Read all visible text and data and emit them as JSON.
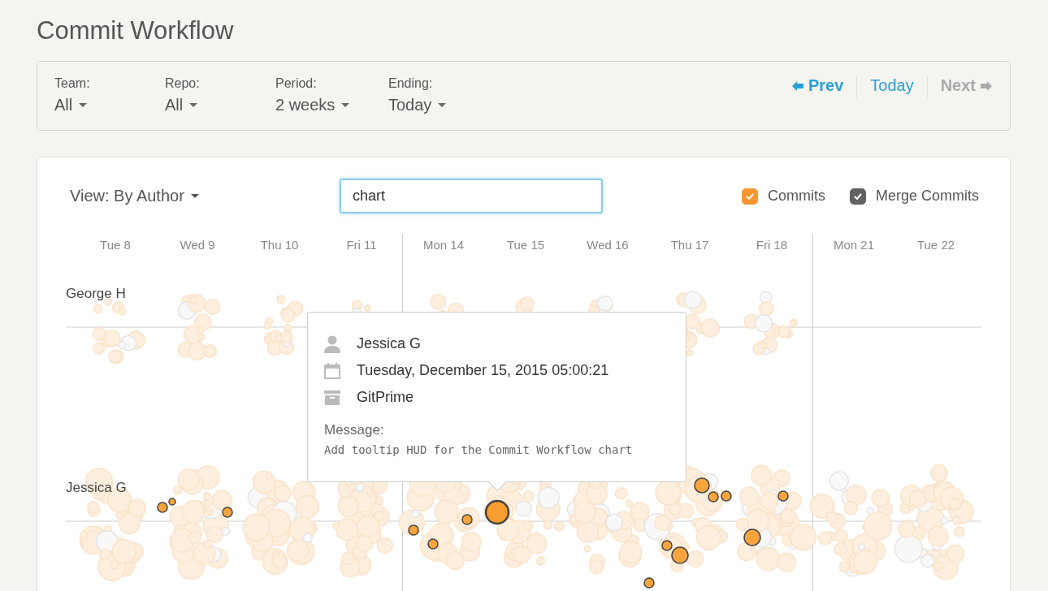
{
  "title": "Commit Workflow",
  "filters": [
    {
      "label": "Team:",
      "value": "All"
    },
    {
      "label": "Repo:",
      "value": "All"
    },
    {
      "label": "Period:",
      "value": "2 weeks"
    },
    {
      "label": "Ending:",
      "value": "Today"
    }
  ],
  "nav": [
    {
      "kind": "prev",
      "label": "Prev",
      "disabled": false
    },
    {
      "kind": "today",
      "label": "Today",
      "disabled": false
    },
    {
      "kind": "next",
      "label": "Next",
      "disabled": true
    }
  ],
  "view": {
    "label": "View: By Author"
  },
  "search": {
    "value": "chart"
  },
  "toggles": [
    {
      "label": "Commits",
      "checked": true,
      "color": "#f7962f"
    },
    {
      "label": "Merge Commits",
      "checked": true,
      "color": "#616161"
    }
  ],
  "days": [
    {
      "label": "Tue 8",
      "week_start": false
    },
    {
      "label": "Wed 9",
      "week_start": false
    },
    {
      "label": "Thu 10",
      "week_start": false
    },
    {
      "label": "Fri 11",
      "week_start": false
    },
    {
      "label": "Mon 14",
      "week_start": true
    },
    {
      "label": "Tue 15",
      "week_start": false
    },
    {
      "label": "Wed 16",
      "week_start": false
    },
    {
      "label": "Thu 17",
      "week_start": false
    },
    {
      "label": "Fri 18",
      "week_start": false
    },
    {
      "label": "Mon 21",
      "week_start": true
    },
    {
      "label": "Tue 22",
      "week_start": false
    }
  ],
  "authors": [
    {
      "name": "George H"
    },
    {
      "name": "Jessica G"
    }
  ],
  "tooltip": {
    "author": "Jessica G",
    "date": "Tuesday, December 15, 2015 05:00:21",
    "repo": "GitPrime",
    "message_label": "Message:",
    "message": "Add tooltip HUD for the Commit Workflow chart"
  }
}
